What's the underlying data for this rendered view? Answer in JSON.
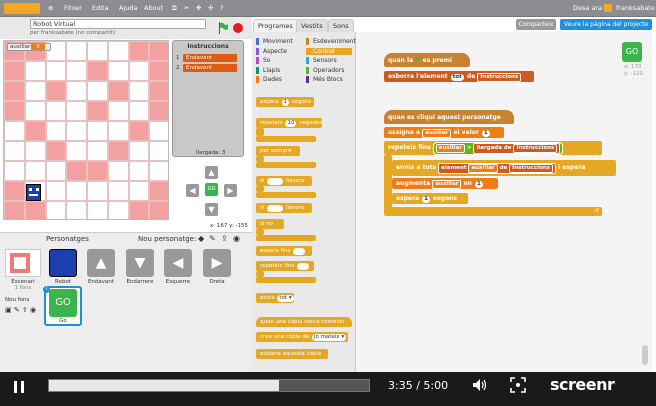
{
  "topbar": {
    "logo_text": "SCRATCH",
    "menus": [
      "Fitxer",
      "Edita",
      "Ajuda",
      "About"
    ],
    "user_left": "Desa ara",
    "user": "franksabate"
  },
  "project": {
    "title": "Robot Virtual",
    "byline": "per franksabate (no compartit)"
  },
  "stage": {
    "variable_label": "auxiliar",
    "variable_value": "0",
    "list_title": "Instruccions",
    "list_items": [
      "Endavant",
      "Endavant"
    ],
    "list_length_label": "llargada: 3",
    "go_label": "GO",
    "coords": "x: 167  y: -155"
  },
  "sprites": {
    "header": "Personatges",
    "new_label": "Nou personatge:",
    "stage_label": "Escenari",
    "stage_sub": "1 fons",
    "new_backdrop_label": "Nou fons",
    "items": [
      {
        "name": "Robot"
      },
      {
        "name": "Endavant"
      },
      {
        "name": "Endarrere"
      },
      {
        "name": "Esquerre"
      },
      {
        "name": "Dreta"
      },
      {
        "name": "Go"
      }
    ]
  },
  "tabs": [
    "Programes",
    "Vestits",
    "Sons"
  ],
  "categories_left": [
    "Moviment",
    "Aspecte",
    "So",
    "Llapis",
    "Dades"
  ],
  "categories_right": [
    "Esdeveniments",
    "Control",
    "Sensors",
    "Operadors",
    "Més Blocs"
  ],
  "cat_colors": {
    "Moviment": "#4a6cd4",
    "Aspecte": "#8a55d7",
    "So": "#bb42c3",
    "Llapis": "#0e9a6c",
    "Dades": "#ee7d16",
    "Esdeveniments": "#c88330",
    "Control": "#e6a822",
    "Sensors": "#2ca5e2",
    "Operadors": "#5cb712",
    "Més Blocs": "#632d99"
  },
  "palette_blocks": {
    "wait": "espera",
    "wait_val": "1",
    "wait_unit": "segons",
    "repeat": "repeteix",
    "repeat_val": "10",
    "repeat_unit": "vegades",
    "forever": "per sempre",
    "if_then": "si",
    "if_then_tail": "llavors",
    "if_else_tail": "llavors",
    "else": "si no",
    "wait_until": "espera fins",
    "repeat_until": "repeteix fins",
    "stop": "atura",
    "stop_opt": "tot",
    "clone_start": "quan una còpia meva comenci",
    "clone_create": "crea una còpia de",
    "clone_opt": "jo mateix",
    "clone_delete": "esborra aquesta còpia"
  },
  "toolbar": {
    "share": "Comparteix",
    "view_page": "Veure la pàgina del projecte"
  },
  "sprite_thumb": {
    "label": "GO",
    "x": "x: 170",
    "y": "y: -120"
  },
  "script1": {
    "hat_pre": "quan la",
    "hat_post": "es premi",
    "line2_pre": "esborra l'element",
    "line2_opt": "tot",
    "line2_mid": "de",
    "line2_list": "Instruccions"
  },
  "script2": {
    "hat": "quan es cliqui aquest personatge",
    "set_pre": "assigna a",
    "set_var": "auxiliar",
    "set_mid": "el valor",
    "set_val": "1",
    "repeat_pre": "repeteix fins",
    "repeat_var": "auxiliar",
    "op": ">",
    "len_pre": "llargada de",
    "len_list": "Instruccions",
    "broadcast_pre": "envia a tots",
    "item_pre": "element",
    "item_var": "auxiliar",
    "item_mid": "de",
    "item_list": "Instruccions",
    "broadcast_post": "i espera",
    "change_pre": "augmenta",
    "change_var": "auxiliar",
    "change_mid": "en",
    "change_val": "1",
    "wait_pre": "espera",
    "wait_val": "1",
    "wait_post": "segons"
  },
  "player": {
    "time": "3:35 / 5:00",
    "progress": 0.72,
    "brand": "screenr"
  }
}
